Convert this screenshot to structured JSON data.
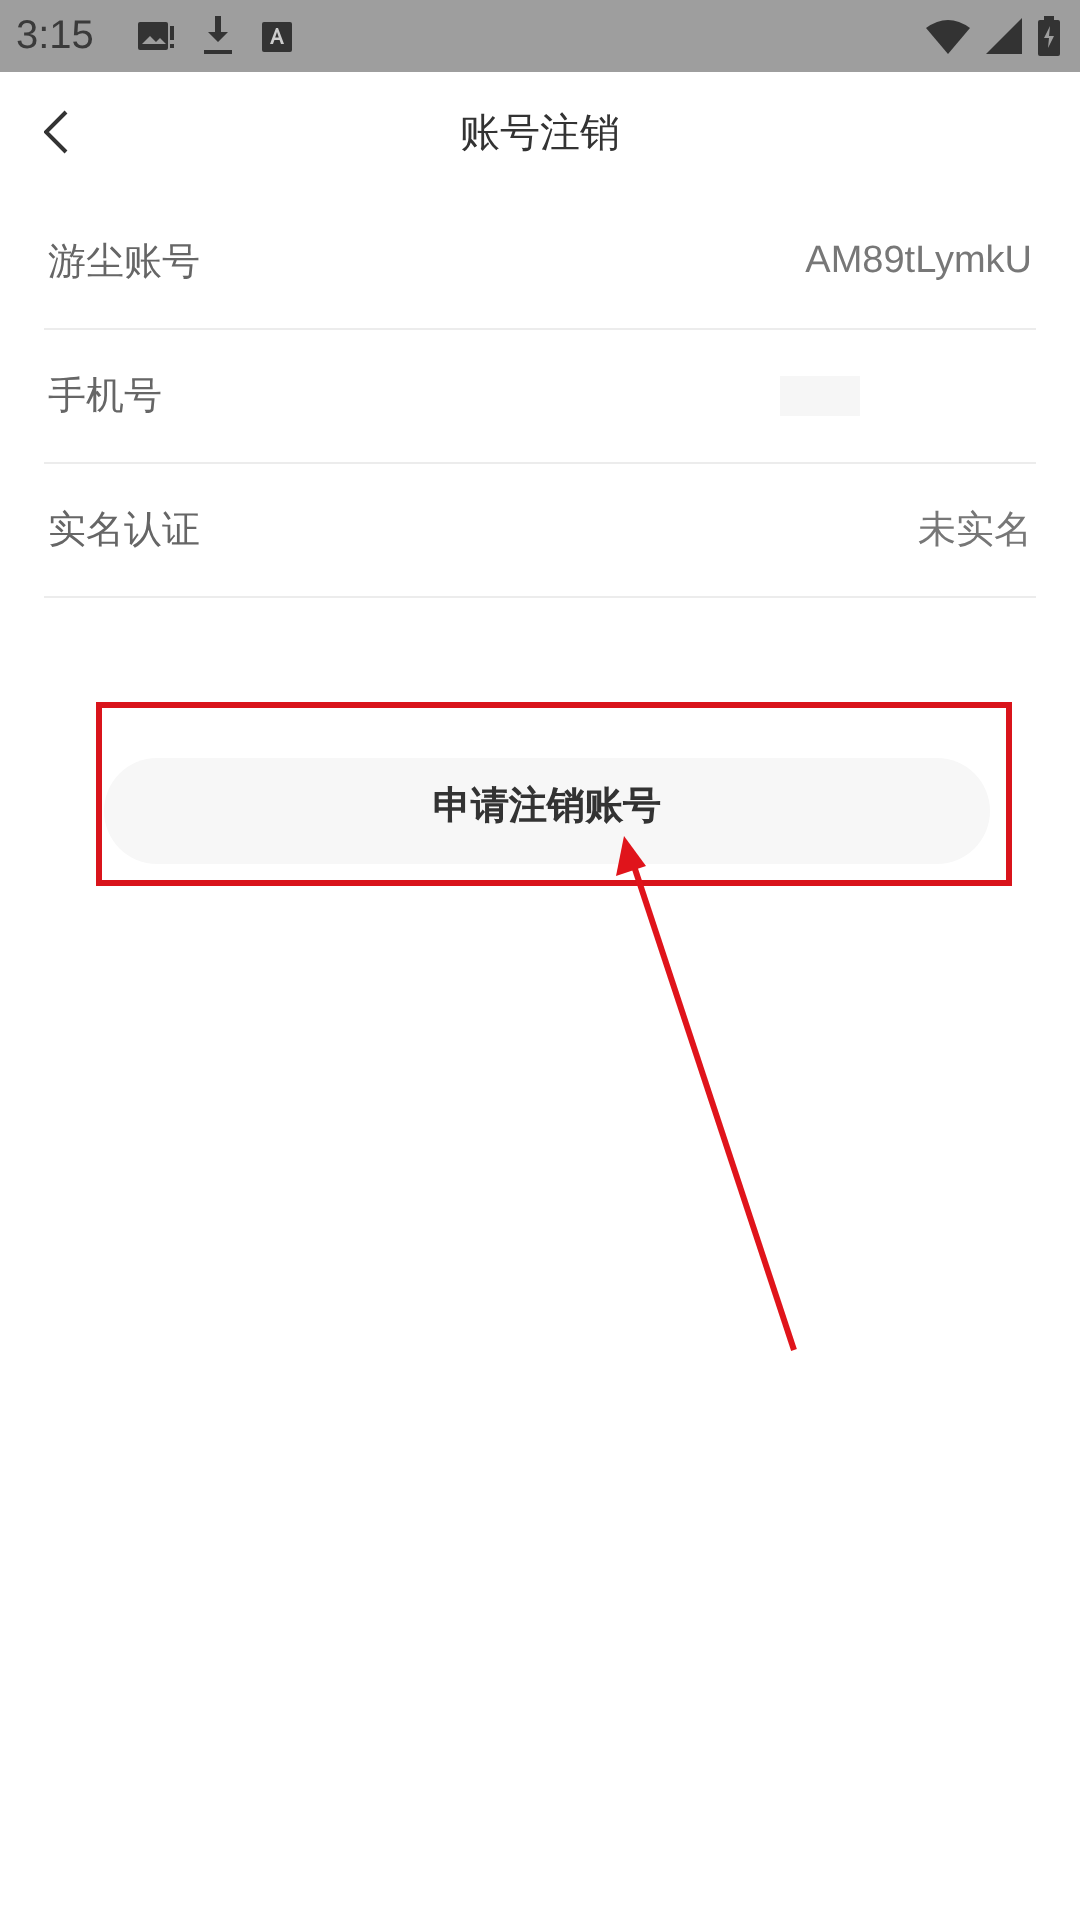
{
  "status_bar": {
    "time": "3:15"
  },
  "header": {
    "title": "账号注销"
  },
  "rows": [
    {
      "kind": "text",
      "label": "游尘账号",
      "value": "AM89tLymkU"
    },
    {
      "kind": "redacted",
      "label": "手机号"
    },
    {
      "kind": "text",
      "label": "实名认证",
      "value": "未实名"
    }
  ],
  "action_button": {
    "label": "申请注销账号"
  }
}
